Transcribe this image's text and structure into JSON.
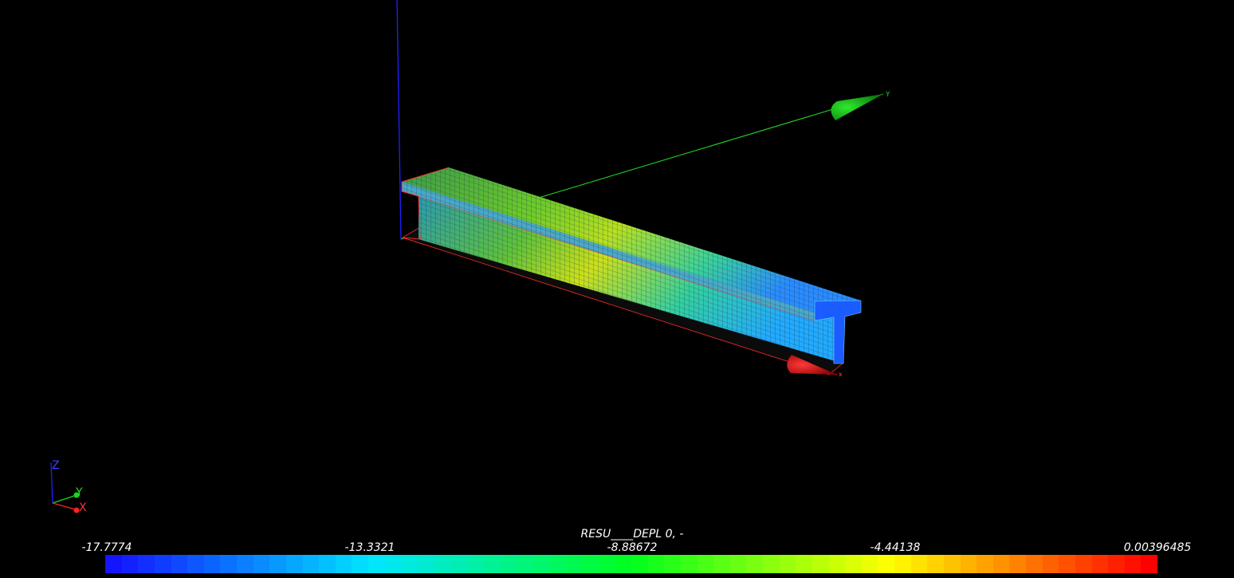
{
  "scene": {
    "background": "#000000",
    "axes_labels": {
      "x": "X",
      "y": "Y",
      "z": "Z"
    },
    "model_axes_labels": {
      "x": "x",
      "y": "Y"
    },
    "axis_colors": {
      "x": "#ff2020",
      "y": "#20d020",
      "z": "#2020ff"
    }
  },
  "scalar_bar": {
    "title": "RESU____DEPL 0, -",
    "ticks": [
      "-17.7774",
      "-13.3321",
      "-8.88672",
      "-4.44138",
      "0.00396485"
    ],
    "range": [
      -17.7774,
      0.00396485
    ],
    "colormap": "blue-cyan-green-yellow-red"
  }
}
